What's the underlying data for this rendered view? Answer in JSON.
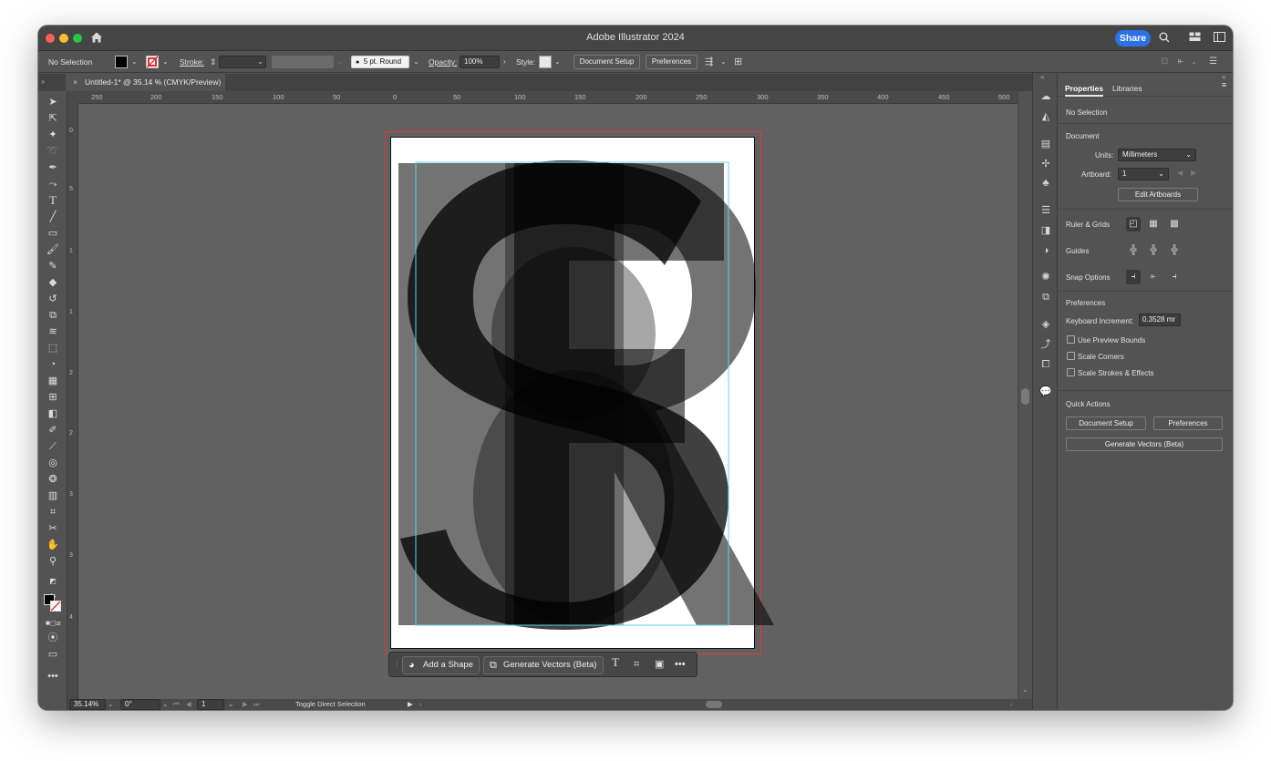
{
  "window": {
    "title": "Adobe Illustrator 2024",
    "share_label": "Share"
  },
  "control_bar": {
    "selection": "No Selection",
    "stroke_label": "Stroke:",
    "brush": "5 pt. Round",
    "opacity_label": "Opacity:",
    "opacity_value": "100%",
    "style_label": "Style:",
    "document_setup": "Document Setup",
    "preferences": "Preferences"
  },
  "document_tab": {
    "title": "Untitled-1* @ 35.14 % (CMYK/Preview)",
    "close": "×"
  },
  "ruler": {
    "h_ticks": [
      "250",
      "200",
      "150",
      "100",
      "50",
      "0",
      "50",
      "100",
      "150",
      "200",
      "250",
      "300",
      "350",
      "400",
      "450",
      "500"
    ],
    "v_ticks": [
      "0",
      "5",
      "1",
      "1",
      "2",
      "2",
      "3",
      "3",
      "4"
    ]
  },
  "context_bar": {
    "add_shape": "Add a Shape",
    "generate_vectors": "Generate Vectors (Beta)"
  },
  "status_bar": {
    "zoom": "35.14%",
    "rotation": "0°",
    "artboard": "1",
    "tool_hint": "Toggle Direct Selection"
  },
  "panel": {
    "tabs": [
      "Properties",
      "Libraries"
    ],
    "selection": "No Selection",
    "document_heading": "Document",
    "units_label": "Units:",
    "units_value": "Millimeters",
    "artboard_label": "Artboard:",
    "artboard_value": "1",
    "edit_artboards": "Edit Artboards",
    "ruler_grids": "Ruler & Grids",
    "guides": "Guides",
    "snap_options": "Snap Options",
    "preferences_heading": "Preferences",
    "keyboard_increment_label": "Keyboard Increment:",
    "keyboard_increment_value": "0.3528 mr",
    "checkboxes": [
      "Use Preview Bounds",
      "Scale Corners",
      "Scale Strokes & Effects"
    ],
    "quick_actions_heading": "Quick Actions",
    "qa_document_setup": "Document Setup",
    "qa_preferences": "Preferences",
    "qa_generate_vectors": "Generate Vectors (Beta)"
  },
  "colors": {
    "accent": "#2a72e5",
    "bleed": "#e03a3a",
    "canvas": "#616161",
    "ui": "#535353"
  }
}
